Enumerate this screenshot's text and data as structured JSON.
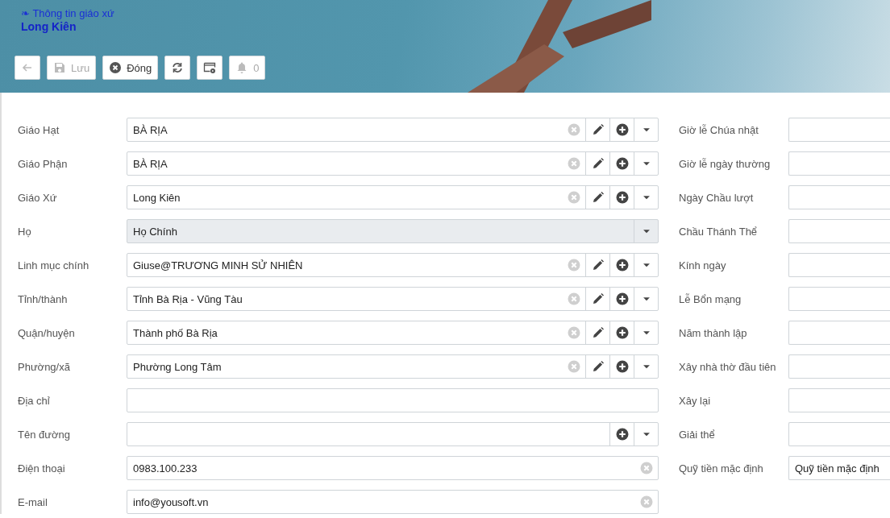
{
  "header": {
    "subtitle": "❧ Thông tin giáo xứ",
    "title": "Long Kiên"
  },
  "toolbar": [
    {
      "kind": "back",
      "disabled": true
    },
    {
      "kind": "save",
      "label": "Lưu",
      "disabled": true
    },
    {
      "kind": "close",
      "label": "Đóng",
      "disabled": false
    },
    {
      "kind": "refresh",
      "disabled": false
    },
    {
      "kind": "window",
      "disabled": false
    },
    {
      "kind": "bell",
      "label": "0",
      "disabled": true
    }
  ],
  "left_fields": [
    {
      "label": "Giáo Hạt",
      "value": "BÀ RỊA",
      "readonly": false,
      "clearable": true,
      "editable": true,
      "addable": true,
      "dropdown": true
    },
    {
      "label": "Giáo Phận",
      "value": "BÀ RỊA",
      "readonly": false,
      "clearable": true,
      "editable": true,
      "addable": true,
      "dropdown": true
    },
    {
      "label": "Giáo Xứ",
      "value": "Long Kiên",
      "readonly": false,
      "clearable": true,
      "editable": true,
      "addable": true,
      "dropdown": true
    },
    {
      "label": "Họ",
      "value": "Họ Chính",
      "readonly": true,
      "clearable": false,
      "editable": false,
      "addable": false,
      "dropdown": true
    },
    {
      "label": "Linh mục chính",
      "value": "Giuse@TRƯƠNG MINH SỬ NHIÊN",
      "readonly": false,
      "clearable": true,
      "editable": true,
      "addable": true,
      "dropdown": true
    },
    {
      "label": "Tỉnh/thành",
      "value": "Tỉnh Bà Rịa - Vũng Tàu",
      "readonly": false,
      "clearable": true,
      "editable": true,
      "addable": true,
      "dropdown": true
    },
    {
      "label": "Quận/huyện",
      "value": "Thành phố Bà Rịa",
      "readonly": false,
      "clearable": true,
      "editable": true,
      "addable": true,
      "dropdown": true
    },
    {
      "label": "Phường/xã",
      "value": "Phường Long Tâm",
      "readonly": false,
      "clearable": true,
      "editable": true,
      "addable": true,
      "dropdown": true
    },
    {
      "label": "Địa chỉ",
      "readonly": false,
      "clearable": false,
      "editable": false,
      "addable": false,
      "dropdown": false
    },
    {
      "label": "Tên đường",
      "readonly": false,
      "clearable": false,
      "editable": false,
      "addable": true,
      "dropdown": true
    },
    {
      "label": "Điện thoại",
      "value": "0983.100.233",
      "readonly": false,
      "clearable": true,
      "editable": false,
      "addable": false,
      "dropdown": false
    },
    {
      "label": "E-mail",
      "value": "info@yousoft.vn",
      "readonly": false,
      "clearable": true,
      "editable": false,
      "addable": false,
      "dropdown": false
    }
  ],
  "right_fields": [
    {
      "label": "Giờ lễ Chúa nhật"
    },
    {
      "label": "Giờ lễ ngày thường"
    },
    {
      "label": "Ngày Chầu lượt"
    },
    {
      "label": "Chầu Thánh Thể"
    },
    {
      "label": "Kính ngày"
    },
    {
      "label": "Lễ Bổn mạng"
    },
    {
      "label": "Năm thành lập"
    },
    {
      "label": "Xây nhà thờ đầu tiên"
    },
    {
      "label": "Xây lại"
    },
    {
      "label": "Giải thể"
    },
    {
      "label": "Quỹ tiền mặc định",
      "value": "Quỹ tiền mặc định"
    }
  ]
}
